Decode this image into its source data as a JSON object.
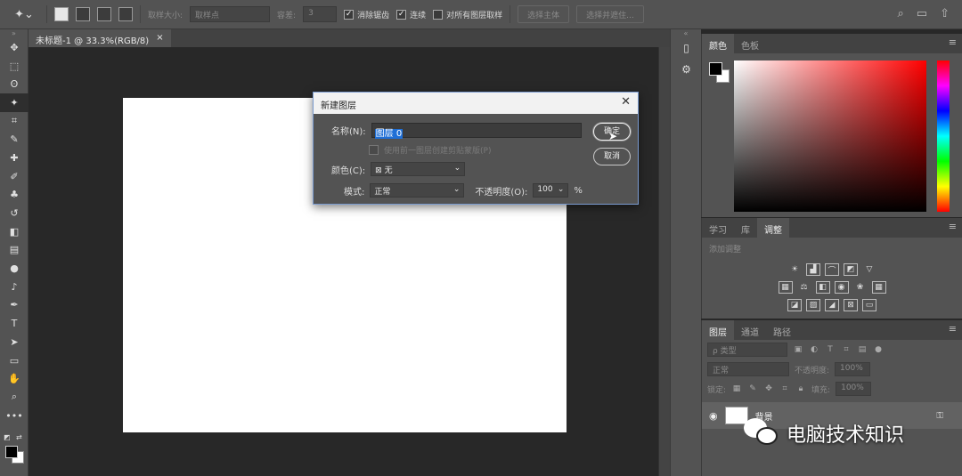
{
  "options_bar": {
    "sample_size_label": "取样大小:",
    "sample_size_value": "取样点",
    "tolerance_label": "容差:",
    "tolerance_value": "3",
    "anti_alias_label": "消除锯齿",
    "contiguous_label": "连续",
    "sample_all_layers_label": "对所有图层取样",
    "select_subject_label": "选择主体",
    "select_and_mask_label": "选择并遮住..."
  },
  "document_tab": {
    "title": "未标题-1 @ 33.3%(RGB/8)",
    "close_glyph": "×"
  },
  "color_panel": {
    "tabs": [
      "颜色",
      "色板"
    ],
    "foreground": "#000000",
    "background": "#ffffff"
  },
  "adjustments_panel": {
    "tabs": [
      "学习",
      "库",
      "调整"
    ],
    "title": "添加调整"
  },
  "layers_panel": {
    "tabs": [
      "图层",
      "通道",
      "路径"
    ],
    "kind_filter": "ρ 类型",
    "blend_mode": "正常",
    "opacity_label": "不透明度:",
    "opacity_value": "100%",
    "lock_label": "锁定:",
    "fill_label": "填充:",
    "fill_value": "100%",
    "layer_name": "背景"
  },
  "dialog": {
    "title": "新建图层",
    "name_label": "名称(N):",
    "name_value": "图层 0",
    "clip_label": "使用前一图层创建剪贴蒙版(P)",
    "color_label": "颜色(C):",
    "color_value": "无",
    "mode_label": "模式:",
    "mode_value": "正常",
    "opacity_label": "不透明度(O):",
    "opacity_value": "100",
    "percent": "%",
    "ok_label": "确定",
    "cancel_label": "取消"
  },
  "watermark": {
    "text": "电脑技术知识"
  }
}
